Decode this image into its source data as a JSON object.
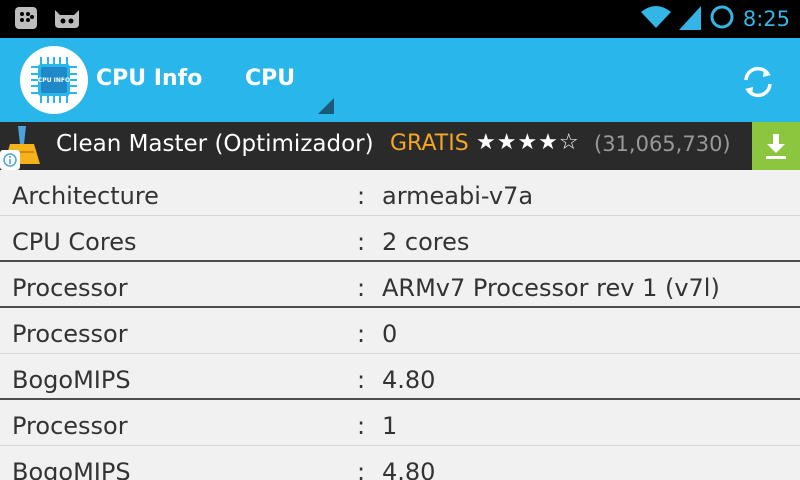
{
  "status_bar": {
    "time": "8:25",
    "left_icons": [
      "bbm-icon",
      "cyanogen-icon"
    ],
    "right_icons": [
      "wifi-icon",
      "signal-icon",
      "battery-icon"
    ],
    "accent": "#33b5e5"
  },
  "action_bar": {
    "app_title": "CPU Info",
    "spinner_label": "CPU",
    "app_icon_text": "CPU INFO",
    "refresh_icon": "refresh-icon",
    "background": "#29b6ea"
  },
  "ad": {
    "title": "Clean Master (Optimizador)",
    "price": "GRATIS",
    "stars": "★★★★☆",
    "rating_count": "(31,065,730)",
    "download_icon": "download-icon"
  },
  "rows": [
    {
      "key": "Architecture",
      "sep": ":",
      "value": "armeabi-v7a"
    },
    {
      "key": "CPU Cores",
      "sep": ":",
      "value": "2 cores"
    },
    {
      "key": "Processor",
      "sep": ":",
      "value": "ARMv7 Processor rev 1 (v7l)"
    },
    {
      "key": "Processor",
      "sep": ":",
      "value": "0"
    },
    {
      "key": "BogoMIPS",
      "sep": ":",
      "value": "4.80"
    },
    {
      "key": "Processor",
      "sep": ":",
      "value": "1"
    },
    {
      "key": "BogoMIPS",
      "sep": ":",
      "value": "4.80"
    }
  ]
}
